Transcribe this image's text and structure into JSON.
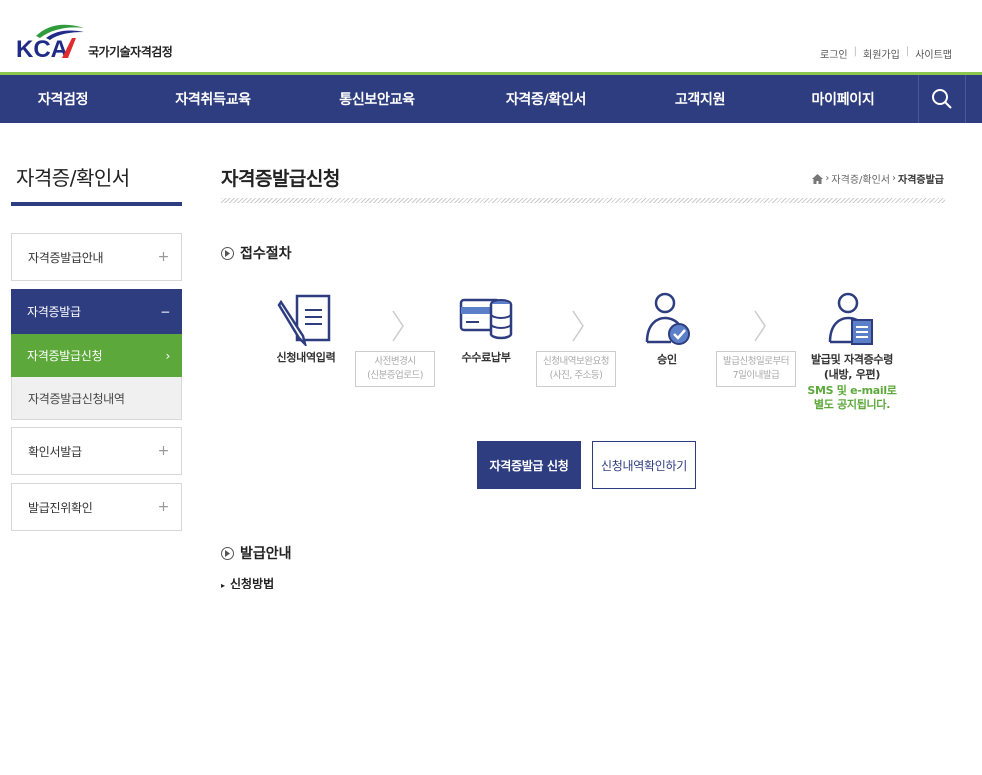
{
  "brand": {
    "abbr": "KCA",
    "name": "국가기술자격검정"
  },
  "util_links": [
    "로그인",
    "회원가입",
    "사이트맵"
  ],
  "nav": [
    "자격검정",
    "자격취득교육",
    "통신보안교육",
    "자격증/확인서",
    "고객지원",
    "마이페이지"
  ],
  "sidebar": {
    "title": "자격증/확인서",
    "items": [
      {
        "label": "자격증발급안내",
        "icon": "+"
      },
      {
        "label": "자격증발급",
        "icon": "−"
      },
      {
        "label": "자격증발급신청",
        "icon": "›"
      },
      {
        "label": "자격증발급신청내역"
      },
      {
        "label": "확인서발급",
        "icon": "+"
      },
      {
        "label": "발급진위확인",
        "icon": "+"
      }
    ]
  },
  "page": {
    "title": "자격증발급신청",
    "breadcrumb": [
      "자격증/확인서",
      "자격증발급"
    ]
  },
  "process": {
    "heading": "접수절차",
    "steps": [
      {
        "label": "신청내역입력",
        "icon": "document-pen-icon"
      },
      {
        "label": "수수료납부",
        "icon": "card-coins-icon"
      },
      {
        "label": "승인",
        "icon": "user-check-icon"
      },
      {
        "label_line1": "발급및 자격증수령",
        "label_line2": "(내방, 우편)",
        "note_line1": "SMS 및 e-mail로",
        "note_line2": "별도 공지됩니다.",
        "icon": "user-document-icon"
      }
    ],
    "between": [
      {
        "line1": "사전변경시",
        "line2": "(신분증업로드)"
      },
      {
        "line1": "신청내역보완요청",
        "line2": "(사진, 주소등)"
      },
      {
        "line1": "발급신청일로부터",
        "line2": "7일이내발급"
      }
    ]
  },
  "buttons": {
    "apply": "자격증발급 신청",
    "check": "신청내역확인하기"
  },
  "guide": {
    "heading": "발급안내",
    "sub": "신청방법"
  },
  "colors": {
    "navy": "#2e3d80",
    "green": "#5da83b",
    "accent_line": "#8bc64f"
  }
}
